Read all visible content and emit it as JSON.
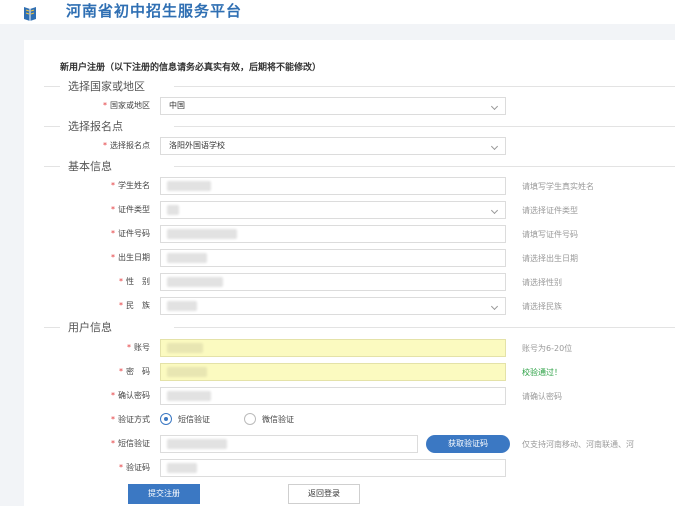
{
  "header": {
    "site_title": "河南省初中招生服务平台"
  },
  "form": {
    "title": "新用户注册（以下注册的信息请务必真实有效，后期将不能修改）",
    "sections": {
      "country": "选择国家或地区",
      "school": "选择报名点",
      "basic": "基本信息",
      "user": "用户信息"
    },
    "fields": {
      "country": {
        "label": "国家或地区",
        "value": "中国"
      },
      "school": {
        "label": "选择报名点",
        "value": "洛阳外国语学校"
      },
      "student_name": {
        "label": "学生姓名",
        "hint": "请填写学生真实姓名"
      },
      "id_type": {
        "label": "证件类型",
        "hint": "请选择证件类型"
      },
      "id_number": {
        "label": "证件号码",
        "hint": "请填写证件号码"
      },
      "birth_date": {
        "label": "出生日期",
        "hint": "请选择出生日期"
      },
      "gender": {
        "label": "性　别",
        "hint": "请选择性别"
      },
      "ethnicity": {
        "label": "民　族",
        "hint": "请选择民族"
      },
      "account": {
        "label": "账号",
        "hint": "账号为6-20位"
      },
      "password": {
        "label": "密　码",
        "hint": "校验通过！"
      },
      "confirm_password": {
        "label": "确认密码",
        "hint": "请确认密码"
      },
      "verify_method": {
        "label": "验证方式",
        "options": [
          "短信验证",
          "微信验证"
        ],
        "selected": "短信验证"
      },
      "sms_code": {
        "label": "短信验证",
        "button": "获取验证码",
        "hint": "仅支持河南移动、河南联通、河"
      },
      "captcha": {
        "label": "验证码"
      }
    },
    "buttons": {
      "submit": "提交注册",
      "back": "返回登录"
    }
  },
  "colors": {
    "brand": "#2f6fb3",
    "button": "#3b78c3",
    "required": "#e4393c",
    "success": "#2aa043",
    "highlight": "#fbfac0"
  }
}
